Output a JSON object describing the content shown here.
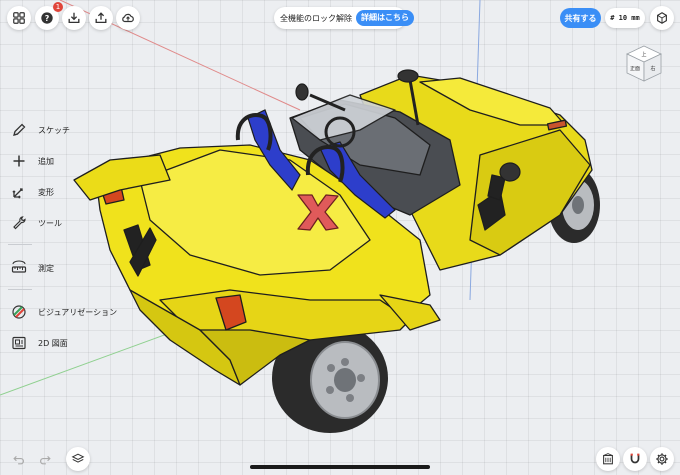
{
  "top_bar": {
    "help_badge_count": "1",
    "unlock_text": "全機能のロック解除",
    "details_button": "詳細はこちら",
    "share_button": "共有する",
    "grid_size": "# 10 mm"
  },
  "viewcube": {
    "top_face": "上",
    "front_face": "正面",
    "right_face": "右"
  },
  "tools": [
    {
      "label": "スケッチ",
      "icon": "pencil-icon"
    },
    {
      "label": "追加",
      "icon": "plus-icon"
    },
    {
      "label": "変形",
      "icon": "transform-icon"
    },
    {
      "label": "ツール",
      "icon": "wrench-icon"
    },
    {
      "label": "測定",
      "icon": "ruler-icon"
    },
    {
      "label": "ビジュアリゼーション",
      "icon": "visualization-icon"
    },
    {
      "label": "2D 図面",
      "icon": "drawing-icon"
    }
  ],
  "colors": {
    "accent": "#3a8ef6",
    "car_body": "#f2e51e",
    "seat": "#2d3ecb",
    "badge": "#e0453a"
  }
}
